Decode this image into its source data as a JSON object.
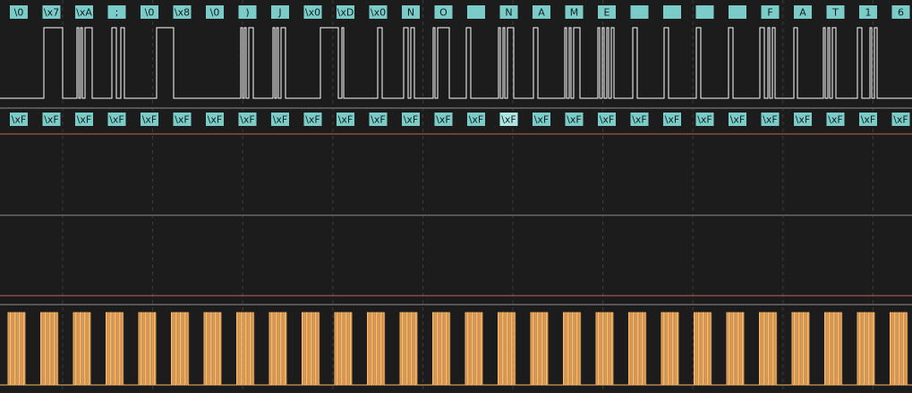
{
  "colors": {
    "background": "#1c1c1c",
    "annotation_fill": "#7bccc8",
    "annotation_fill_alt": "#aee6e3",
    "annotation_text": "#102020",
    "signal_white": "#ffffff",
    "signal_clock": "#ffb865",
    "channel_separator": "#555555",
    "trigger_line": "#c2635a",
    "grid_dashed": "#3c3c3c"
  },
  "channels": {
    "data": {
      "decoded_labels": [
        "\\0",
        "\\x7",
        "\\xA",
        ";",
        "\\0",
        "\\x8",
        "\\0",
        ")",
        "J",
        "\\x0",
        "\\xD",
        "\\x0",
        "N",
        "O",
        "",
        "N",
        "A",
        "M",
        "E",
        "",
        "",
        "",
        "",
        "F",
        "A",
        "T",
        "1",
        "6"
      ],
      "pulses": [
        [
          49,
          70
        ],
        [
          86,
          88
        ],
        [
          90,
          92
        ],
        [
          95,
          103
        ],
        [
          125,
          130
        ],
        [
          135,
          139
        ],
        [
          175,
          194
        ],
        [
          269,
          271
        ],
        [
          273,
          275
        ],
        [
          278,
          283
        ],
        [
          305,
          307
        ],
        [
          309,
          311
        ],
        [
          314,
          319
        ],
        [
          358,
          378
        ],
        [
          382,
          384
        ],
        [
          422,
          427
        ],
        [
          451,
          456
        ],
        [
          459,
          463
        ],
        [
          484,
          486
        ],
        [
          489,
          502
        ],
        [
          521,
          526
        ],
        [
          557,
          559
        ],
        [
          562,
          564
        ],
        [
          567,
          574
        ],
        [
          596,
          601
        ],
        [
          631,
          633
        ],
        [
          636,
          638
        ],
        [
          641,
          648
        ],
        [
          668,
          670
        ],
        [
          673,
          675
        ],
        [
          678,
          680
        ],
        [
          683,
          686
        ],
        [
          707,
          712
        ],
        [
          742,
          747
        ],
        [
          778,
          783
        ],
        [
          814,
          819
        ],
        [
          849,
          854
        ],
        [
          858,
          860
        ],
        [
          863,
          866
        ],
        [
          887,
          891
        ],
        [
          920,
          922
        ],
        [
          925,
          927
        ],
        [
          930,
          934
        ],
        [
          958,
          963
        ],
        [
          972,
          974
        ],
        [
          977,
          980
        ]
      ]
    },
    "data2": {
      "decoded_labels": [
        "\\xF",
        "\\xF",
        "\\xF",
        "\\xF",
        "\\xF",
        "\\xF",
        "\\xF",
        "\\xF",
        "\\xF",
        "\\xF",
        "\\xF",
        "\\xF",
        "\\xF",
        "\\xF",
        "\\xF",
        "\\xF",
        "\\xF",
        "\\xF",
        "\\xF",
        "\\xF",
        "\\xF",
        "\\xF",
        "\\xF",
        "\\xF",
        "\\xF",
        "\\xF",
        "\\xF",
        "\\xF"
      ],
      "highlighted_index": 15
    },
    "clock": {
      "bursts": 28,
      "pulses_per_burst": 8
    }
  }
}
